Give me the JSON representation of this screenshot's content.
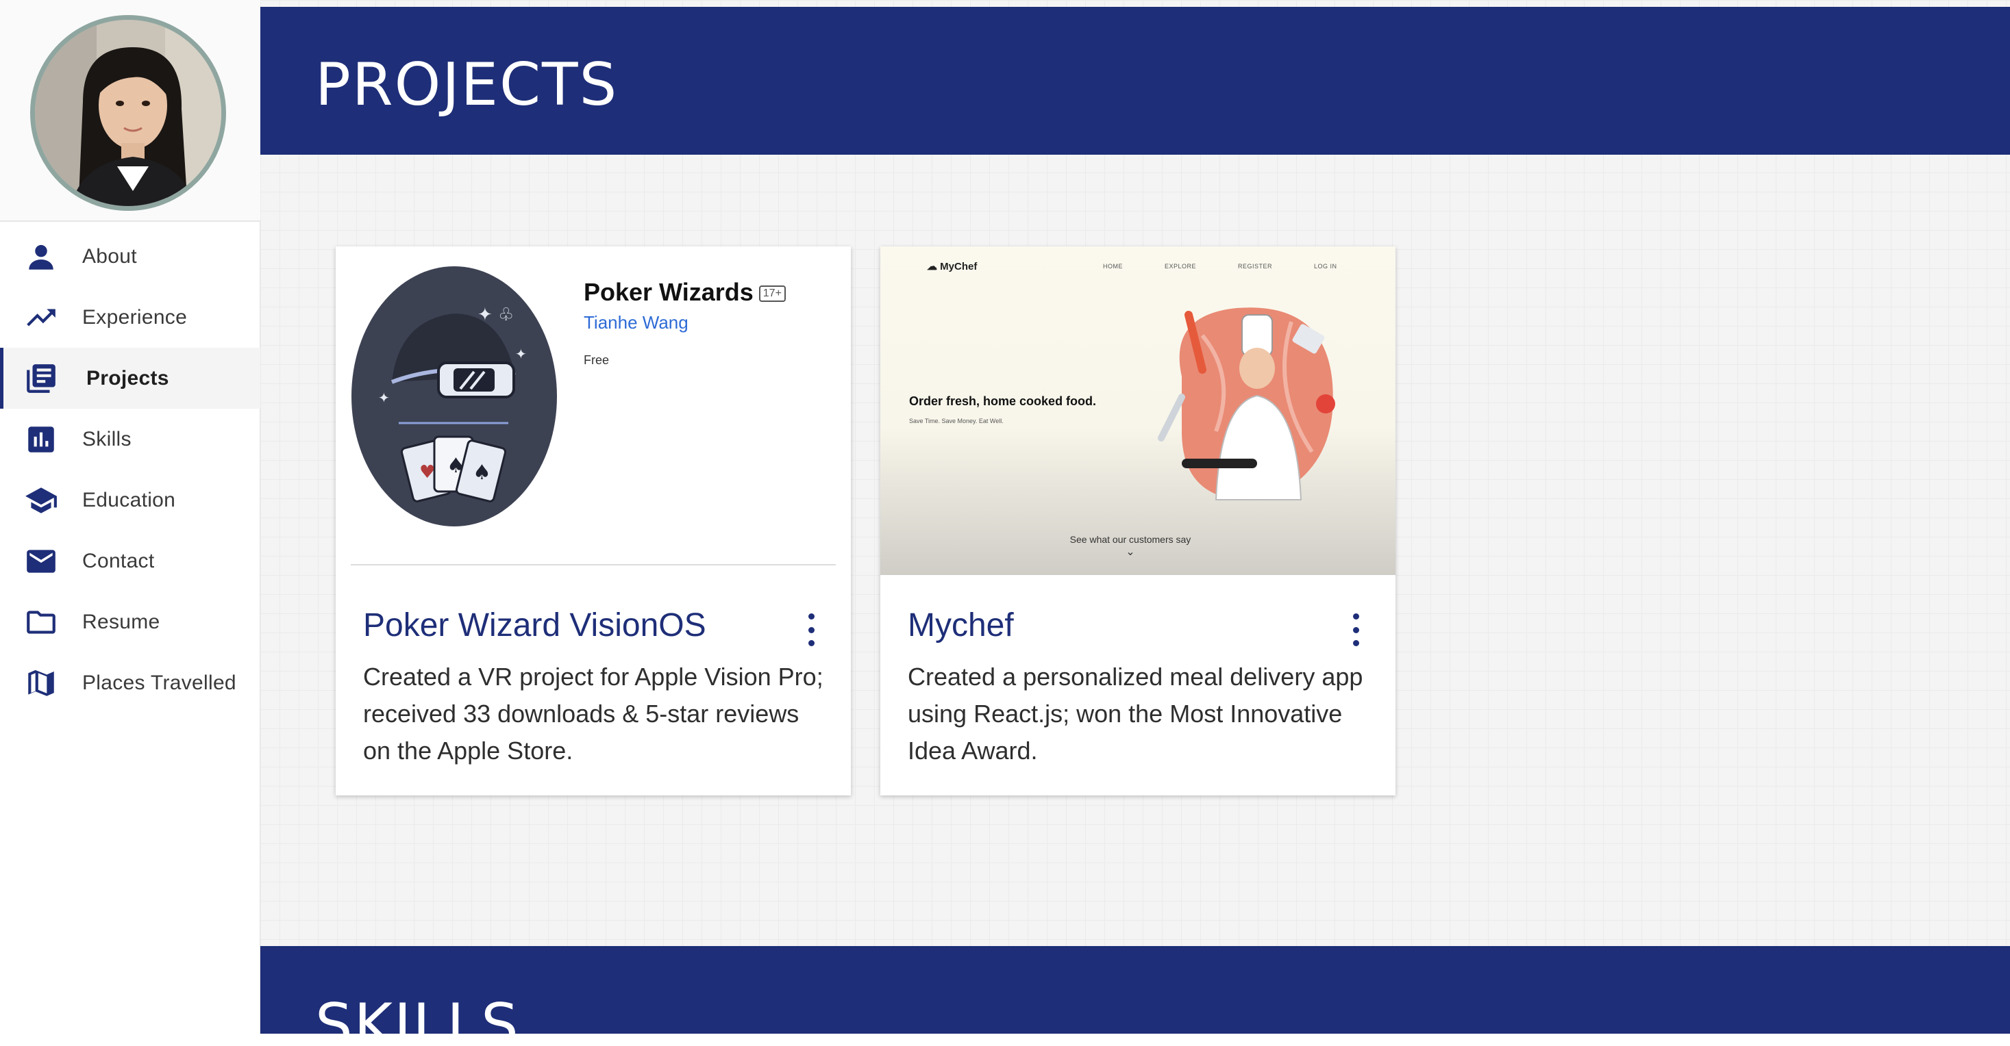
{
  "sidebar": {
    "profile_photo": "avatar-photo",
    "items": [
      {
        "label": "About",
        "icon": "person-icon"
      },
      {
        "label": "Experience",
        "icon": "trending-up-icon"
      },
      {
        "label": "Projects",
        "icon": "document-list-icon",
        "active": true
      },
      {
        "label": "Skills",
        "icon": "bar-chart-icon"
      },
      {
        "label": "Education",
        "icon": "graduation-cap-icon"
      },
      {
        "label": "Contact",
        "icon": "mail-icon"
      },
      {
        "label": "Resume",
        "icon": "folder-icon"
      },
      {
        "label": "Places Travelled",
        "icon": "map-icon"
      }
    ]
  },
  "main": {
    "section_title": "PROJECTS",
    "next_section_title": "SKILLS",
    "projects": [
      {
        "title": "Poker Wizard VisionOS",
        "description": "Created a VR project for Apple Vision Pro; received 33 downloads & 5-star reviews on the Apple Store.",
        "store_tile": {
          "app_name": "Poker Wizards",
          "age_rating": "17+",
          "developer": "Tianhe Wang",
          "price": "Free"
        }
      },
      {
        "title": "Mychef",
        "description": "Created a personalized meal delivery app using React.js; won the Most Innovative Idea Award.",
        "screenshot": {
          "logo": "MyChef",
          "nav": [
            "HOME",
            "EXPLORE",
            "REGISTER",
            "LOG IN"
          ],
          "headline": "Order fresh, home cooked food.",
          "subline": "Save Time. Save Money. Eat Well.",
          "cta": "See what our customers say"
        }
      }
    ]
  },
  "colors": {
    "primary": "#1e2e78",
    "background": "#f4f4f4",
    "link": "#2e6bd6"
  }
}
